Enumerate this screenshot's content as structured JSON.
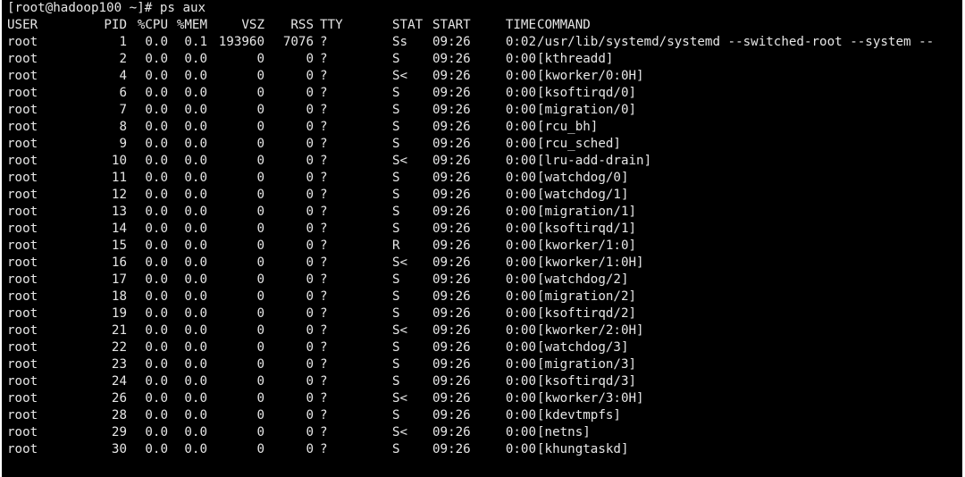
{
  "terminal": {
    "prompt": "[root@hadoop100 ~]# ps aux",
    "colors": {
      "background": "#000000",
      "foreground": "#e6e6e6"
    },
    "headers": {
      "user": "USER",
      "pid": "PID",
      "cpu": "%CPU",
      "mem": "%MEM",
      "vsz": "VSZ",
      "rss": "RSS",
      "tty": "TTY",
      "stat": "STAT",
      "start": "START",
      "time": "TIME",
      "command": "COMMAND"
    },
    "rows": [
      {
        "user": "root",
        "pid": "1",
        "cpu": "0.0",
        "mem": "0.1",
        "vsz": "193960",
        "rss": "7076",
        "tty": "?",
        "stat": "Ss",
        "start": "09:26",
        "time": "0:02",
        "command": "/usr/lib/systemd/systemd --switched-root --system --"
      },
      {
        "user": "root",
        "pid": "2",
        "cpu": "0.0",
        "mem": "0.0",
        "vsz": "0",
        "rss": "0",
        "tty": "?",
        "stat": "S",
        "start": "09:26",
        "time": "0:00",
        "command": "[kthreadd]"
      },
      {
        "user": "root",
        "pid": "4",
        "cpu": "0.0",
        "mem": "0.0",
        "vsz": "0",
        "rss": "0",
        "tty": "?",
        "stat": "S<",
        "start": "09:26",
        "time": "0:00",
        "command": "[kworker/0:0H]"
      },
      {
        "user": "root",
        "pid": "6",
        "cpu": "0.0",
        "mem": "0.0",
        "vsz": "0",
        "rss": "0",
        "tty": "?",
        "stat": "S",
        "start": "09:26",
        "time": "0:00",
        "command": "[ksoftirqd/0]"
      },
      {
        "user": "root",
        "pid": "7",
        "cpu": "0.0",
        "mem": "0.0",
        "vsz": "0",
        "rss": "0",
        "tty": "?",
        "stat": "S",
        "start": "09:26",
        "time": "0:00",
        "command": "[migration/0]"
      },
      {
        "user": "root",
        "pid": "8",
        "cpu": "0.0",
        "mem": "0.0",
        "vsz": "0",
        "rss": "0",
        "tty": "?",
        "stat": "S",
        "start": "09:26",
        "time": "0:00",
        "command": "[rcu_bh]"
      },
      {
        "user": "root",
        "pid": "9",
        "cpu": "0.0",
        "mem": "0.0",
        "vsz": "0",
        "rss": "0",
        "tty": "?",
        "stat": "S",
        "start": "09:26",
        "time": "0:00",
        "command": "[rcu_sched]"
      },
      {
        "user": "root",
        "pid": "10",
        "cpu": "0.0",
        "mem": "0.0",
        "vsz": "0",
        "rss": "0",
        "tty": "?",
        "stat": "S<",
        "start": "09:26",
        "time": "0:00",
        "command": "[lru-add-drain]"
      },
      {
        "user": "root",
        "pid": "11",
        "cpu": "0.0",
        "mem": "0.0",
        "vsz": "0",
        "rss": "0",
        "tty": "?",
        "stat": "S",
        "start": "09:26",
        "time": "0:00",
        "command": "[watchdog/0]"
      },
      {
        "user": "root",
        "pid": "12",
        "cpu": "0.0",
        "mem": "0.0",
        "vsz": "0",
        "rss": "0",
        "tty": "?",
        "stat": "S",
        "start": "09:26",
        "time": "0:00",
        "command": "[watchdog/1]"
      },
      {
        "user": "root",
        "pid": "13",
        "cpu": "0.0",
        "mem": "0.0",
        "vsz": "0",
        "rss": "0",
        "tty": "?",
        "stat": "S",
        "start": "09:26",
        "time": "0:00",
        "command": "[migration/1]"
      },
      {
        "user": "root",
        "pid": "14",
        "cpu": "0.0",
        "mem": "0.0",
        "vsz": "0",
        "rss": "0",
        "tty": "?",
        "stat": "S",
        "start": "09:26",
        "time": "0:00",
        "command": "[ksoftirqd/1]"
      },
      {
        "user": "root",
        "pid": "15",
        "cpu": "0.0",
        "mem": "0.0",
        "vsz": "0",
        "rss": "0",
        "tty": "?",
        "stat": "R",
        "start": "09:26",
        "time": "0:00",
        "command": "[kworker/1:0]"
      },
      {
        "user": "root",
        "pid": "16",
        "cpu": "0.0",
        "mem": "0.0",
        "vsz": "0",
        "rss": "0",
        "tty": "?",
        "stat": "S<",
        "start": "09:26",
        "time": "0:00",
        "command": "[kworker/1:0H]"
      },
      {
        "user": "root",
        "pid": "17",
        "cpu": "0.0",
        "mem": "0.0",
        "vsz": "0",
        "rss": "0",
        "tty": "?",
        "stat": "S",
        "start": "09:26",
        "time": "0:00",
        "command": "[watchdog/2]"
      },
      {
        "user": "root",
        "pid": "18",
        "cpu": "0.0",
        "mem": "0.0",
        "vsz": "0",
        "rss": "0",
        "tty": "?",
        "stat": "S",
        "start": "09:26",
        "time": "0:00",
        "command": "[migration/2]"
      },
      {
        "user": "root",
        "pid": "19",
        "cpu": "0.0",
        "mem": "0.0",
        "vsz": "0",
        "rss": "0",
        "tty": "?",
        "stat": "S",
        "start": "09:26",
        "time": "0:00",
        "command": "[ksoftirqd/2]"
      },
      {
        "user": "root",
        "pid": "21",
        "cpu": "0.0",
        "mem": "0.0",
        "vsz": "0",
        "rss": "0",
        "tty": "?",
        "stat": "S<",
        "start": "09:26",
        "time": "0:00",
        "command": "[kworker/2:0H]"
      },
      {
        "user": "root",
        "pid": "22",
        "cpu": "0.0",
        "mem": "0.0",
        "vsz": "0",
        "rss": "0",
        "tty": "?",
        "stat": "S",
        "start": "09:26",
        "time": "0:00",
        "command": "[watchdog/3]"
      },
      {
        "user": "root",
        "pid": "23",
        "cpu": "0.0",
        "mem": "0.0",
        "vsz": "0",
        "rss": "0",
        "tty": "?",
        "stat": "S",
        "start": "09:26",
        "time": "0:00",
        "command": "[migration/3]"
      },
      {
        "user": "root",
        "pid": "24",
        "cpu": "0.0",
        "mem": "0.0",
        "vsz": "0",
        "rss": "0",
        "tty": "?",
        "stat": "S",
        "start": "09:26",
        "time": "0:00",
        "command": "[ksoftirqd/3]"
      },
      {
        "user": "root",
        "pid": "26",
        "cpu": "0.0",
        "mem": "0.0",
        "vsz": "0",
        "rss": "0",
        "tty": "?",
        "stat": "S<",
        "start": "09:26",
        "time": "0:00",
        "command": "[kworker/3:0H]"
      },
      {
        "user": "root",
        "pid": "28",
        "cpu": "0.0",
        "mem": "0.0",
        "vsz": "0",
        "rss": "0",
        "tty": "?",
        "stat": "S",
        "start": "09:26",
        "time": "0:00",
        "command": "[kdevtmpfs]"
      },
      {
        "user": "root",
        "pid": "29",
        "cpu": "0.0",
        "mem": "0.0",
        "vsz": "0",
        "rss": "0",
        "tty": "?",
        "stat": "S<",
        "start": "09:26",
        "time": "0:00",
        "command": "[netns]"
      },
      {
        "user": "root",
        "pid": "30",
        "cpu": "0.0",
        "mem": "0.0",
        "vsz": "0",
        "rss": "0",
        "tty": "?",
        "stat": "S",
        "start": "09:26",
        "time": "0:00",
        "command": "[khungtaskd]"
      }
    ]
  }
}
